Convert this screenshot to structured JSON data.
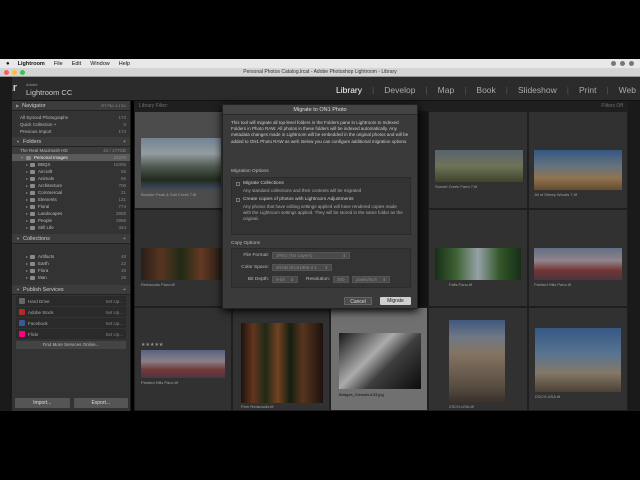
{
  "mac_menu": {
    "apple": "",
    "app": "Lightroom",
    "items": [
      "File",
      "Edit",
      "Window",
      "Help"
    ]
  },
  "window": {
    "title": "Personal Photos Catalog.lrcat - Adobe Photoshop Lightroom - Library"
  },
  "brand": {
    "logo": "Lr",
    "small": "Adobe",
    "name": "Lightroom CC"
  },
  "modules": [
    "Library",
    "Develop",
    "Map",
    "Book",
    "Slideshow",
    "Print",
    "Web"
  ],
  "navigator": {
    "title": "Navigator",
    "controls": "FIT FILL 1:1 3:1"
  },
  "catalog": {
    "items": [
      {
        "label": "All Synced Photographs",
        "count": "173"
      },
      {
        "label": "Quick Collection +",
        "count": "0"
      },
      {
        "label": "Previous Import",
        "count": "174"
      }
    ]
  },
  "folders": {
    "title": "Folders",
    "drive": {
      "label": "The Real Macintosh HD",
      "count": "42 / 177GB"
    },
    "root": {
      "label": "Personal Images",
      "count": "24229"
    },
    "items": [
      {
        "label": "BBQX",
        "count": "15306"
      },
      {
        "label": "Aircraft",
        "count": "58"
      },
      {
        "label": "Animals",
        "count": "66"
      },
      {
        "label": "Architecture",
        "count": "706"
      },
      {
        "label": "Commercial",
        "count": "21"
      },
      {
        "label": "Elements",
        "count": "131"
      },
      {
        "label": "Floral",
        "count": "774"
      },
      {
        "label": "Landscapes",
        "count": "3808"
      },
      {
        "label": "People",
        "count": "2988"
      },
      {
        "label": "Still Life",
        "count": "344"
      }
    ]
  },
  "collections": {
    "title": "Collections",
    "items": [
      {
        "label": "Artifacts",
        "count": "48"
      },
      {
        "label": "Earth",
        "count": "22"
      },
      {
        "label": "Flora",
        "count": "18"
      },
      {
        "label": "Man",
        "count": "28"
      }
    ]
  },
  "publish": {
    "title": "Publish Services",
    "items": [
      {
        "label": "Hard Drive",
        "action": "Set Up..."
      },
      {
        "label": "Adobe Stock",
        "action": "Set Up..."
      },
      {
        "label": "Facebook",
        "action": "Set Up..."
      },
      {
        "label": "Flickr",
        "action": "Set Up..."
      }
    ],
    "find_more": "Find More Services Online..."
  },
  "buttons": {
    "import": "Import...",
    "export": "Export..."
  },
  "grid": {
    "filter_label": "Library Filter:",
    "filter_right": "Filters Off",
    "captions": {
      "c1": "Boulder Peak & Salt Creek 7.tif",
      "c2": "Sunset Creek Farm 7.tif",
      "c3": "Jill of Sheep Woods 7.tif",
      "c4": "Redwoods Pano.tif",
      "c5": "Falls Pano.tif",
      "c6": "Painted Hills Pano.tif",
      "c7": "Painted Hills Pano.tif",
      "c8": "Fern Redwoods.tif",
      "c9": "Bridges_Clemshu133.jpg",
      "c10": "ZSCH-USA.tif",
      "c11": "DSCH-USA.tif"
    },
    "stars": "★★★★★"
  },
  "dialog": {
    "title": "Migrate to ON1 Photo",
    "intro": "This tool will migrate all top-level folders in the Folders pane in Lightroom to Indexed Folders in Photo RAW. All photos in these folders will be indexed automatically. Any metadata changes made in Lightroom will be embedded in the original photos and will be added to ON1 Photo RAW as well. Below you can configure additional migration options.",
    "migration_options_label": "Migration Options",
    "migrate_collections": "Migrate Collections",
    "migrate_collections_sub": "Any standard collections and their contents will be migrated",
    "create_copies": "Create copies of photos with Lightroom Adjustments",
    "create_copies_sub": "Any photos that have editing settings applied will have rendered copies made with the Lightroom settings applied. They will be stored in the same folder as the original.",
    "copy_options_label": "Copy Options",
    "file_format_label": "File Format:",
    "file_format_value": "JPEG (No Layers)",
    "color_space_label": "Color Space:",
    "color_space_value": "sRGB IEC61966-2.1",
    "bit_depth_label": "Bit Depth:",
    "bit_depth_value": "8-bit",
    "resolution_label": "Resolution:",
    "resolution_value": "300",
    "resolution_unit": "pixels/inch",
    "cancel": "Cancel",
    "migrate": "Migrate"
  }
}
